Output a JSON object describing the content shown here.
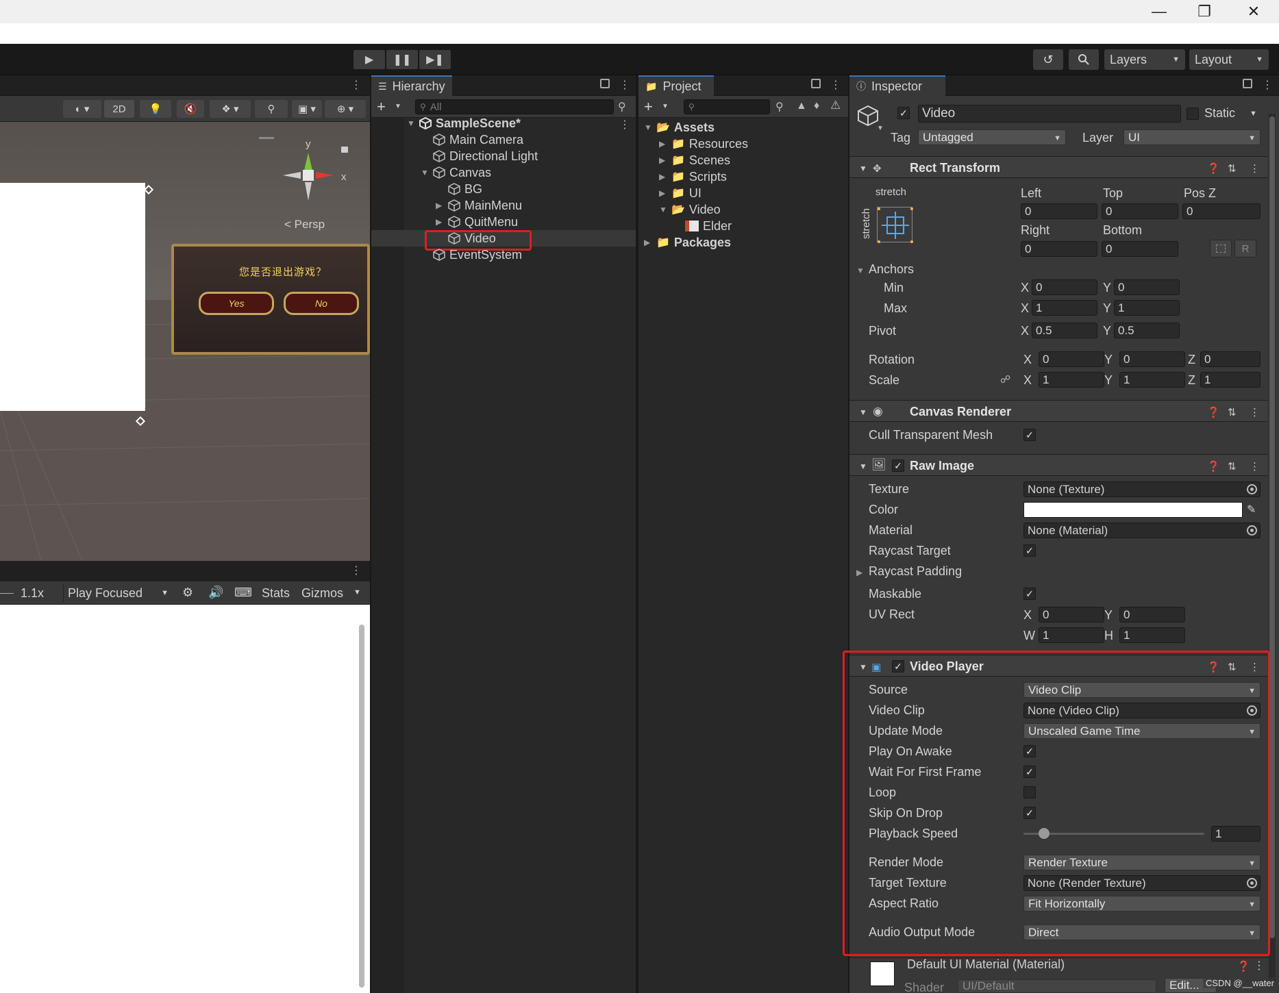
{
  "toolbar": {
    "layers_label": "Layers",
    "layout_label": "Layout"
  },
  "scene": {
    "mode_2d": "2D",
    "persp_label": "Persp",
    "gizmo_y": "y",
    "gizmo_x": "x",
    "dialog_text": "您是否退出游戏？",
    "dialog_yes": "Yes",
    "dialog_no": "No"
  },
  "game": {
    "scale_value": "1.1x",
    "play_mode": "Play Focused",
    "stats_label": "Stats",
    "gizmos_label": "Gizmos"
  },
  "hierarchy": {
    "tab_label": "Hierarchy",
    "search_placeholder": "All",
    "scene_name": "SampleScene*",
    "items": [
      "Main Camera",
      "Directional Light",
      "Canvas",
      "BG",
      "MainMenu",
      "QuitMenu",
      "Video",
      "EventSystem"
    ]
  },
  "project": {
    "tab_label": "Project",
    "assets_label": "Assets",
    "folders": [
      "Resources",
      "Scenes",
      "Scripts",
      "UI",
      "Video"
    ],
    "video_child": "Elder",
    "packages_label": "Packages"
  },
  "inspector": {
    "tab_label": "Inspector",
    "object_name": "Video",
    "static_label": "Static",
    "tag_label": "Tag",
    "tag_value": "Untagged",
    "layer_label": "Layer",
    "layer_value": "UI",
    "rect_transform": {
      "title": "Rect Transform",
      "stretch_label": "stretch",
      "left_label": "Left",
      "top_label": "Top",
      "posz_label": "Pos Z",
      "left": "0",
      "top": "0",
      "posz": "0",
      "right_label": "Right",
      "bottom_label": "Bottom",
      "right": "0",
      "bottom": "0",
      "anchors_label": "Anchors",
      "min_label": "Min",
      "max_label": "Max",
      "min_x": "0",
      "min_y": "0",
      "max_x": "1",
      "max_y": "1",
      "pivot_label": "Pivot",
      "pivot_x": "0.5",
      "pivot_y": "0.5",
      "rotation_label": "Rotation",
      "rot_x": "0",
      "rot_y": "0",
      "rot_z": "0",
      "scale_label": "Scale",
      "scale_x": "1",
      "scale_y": "1",
      "scale_z": "1",
      "r_button": "R"
    },
    "canvas_renderer": {
      "title": "Canvas Renderer",
      "cull_label": "Cull Transparent Mesh"
    },
    "raw_image": {
      "title": "Raw Image",
      "texture_label": "Texture",
      "texture_value": "None (Texture)",
      "color_label": "Color",
      "material_label": "Material",
      "material_value": "None (Material)",
      "raycast_target_label": "Raycast Target",
      "raycast_padding_label": "Raycast Padding",
      "maskable_label": "Maskable",
      "uvrect_label": "UV Rect",
      "uv_x": "0",
      "uv_y": "0",
      "uv_w": "1",
      "uv_h": "1"
    },
    "video_player": {
      "title": "Video Player",
      "source_label": "Source",
      "source_value": "Video Clip",
      "clip_label": "Video Clip",
      "clip_value": "None (Video Clip)",
      "update_label": "Update Mode",
      "update_value": "Unscaled Game Time",
      "play_on_awake_label": "Play On Awake",
      "wait_label": "Wait For First Frame",
      "loop_label": "Loop",
      "skip_label": "Skip On Drop",
      "speed_label": "Playback Speed",
      "speed_value": "1",
      "render_mode_label": "Render Mode",
      "render_mode_value": "Render Texture",
      "target_label": "Target Texture",
      "target_value": "None (Render Texture)",
      "aspect_label": "Aspect Ratio",
      "aspect_value": "Fit Horizontally",
      "audio_label": "Audio Output Mode",
      "audio_value": "Direct"
    },
    "material": {
      "title": "Default UI Material (Material)",
      "shader_label": "Shader",
      "shader_value": "UI/Default",
      "edit_label": "Edit..."
    }
  },
  "watermark": "CSDN @__water",
  "axis_labels": {
    "x": "X",
    "y": "Y",
    "z": "Z",
    "w": "W",
    "h": "H"
  }
}
